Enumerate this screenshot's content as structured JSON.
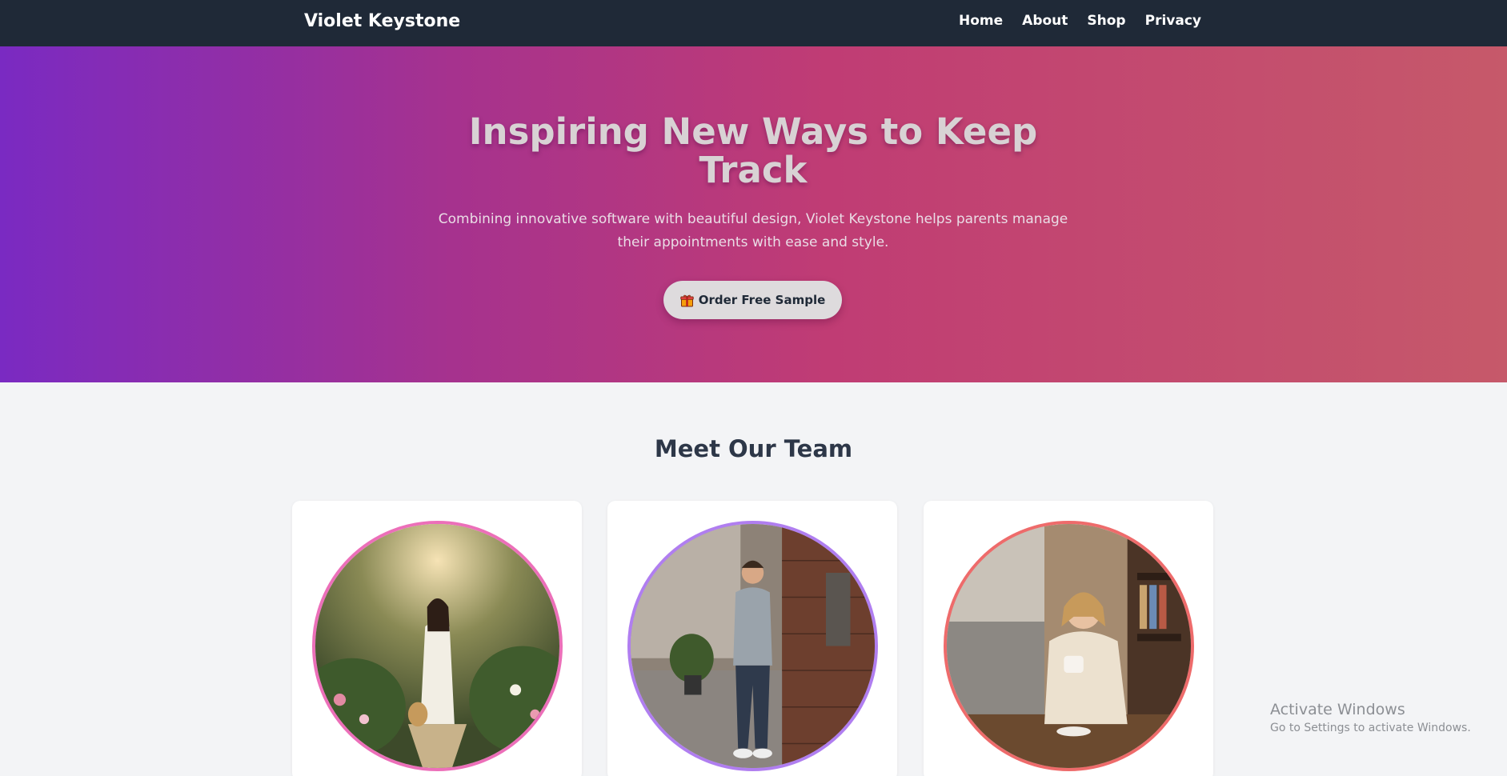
{
  "nav": {
    "brand": "Violet Keystone",
    "links": [
      "Home",
      "About",
      "Shop",
      "Privacy"
    ]
  },
  "hero": {
    "title": "Inspiring New Ways to Keep Track",
    "subtitle": "Combining innovative software with beautiful design, Violet Keystone helps parents manage their appointments with ease and style.",
    "cta_label": "Order Free Sample",
    "cta_icon": "gift-icon"
  },
  "team": {
    "title": "Meet Our Team",
    "members": [
      {
        "photo": "woman-in-garden-photo",
        "ring_color": "#ec6fb9"
      },
      {
        "photo": "man-leaning-on-brick-wall-photo",
        "ring_color": "#b07ef0"
      },
      {
        "photo": "woman-with-coffee-photo",
        "ring_color": "#ee6b6b"
      }
    ]
  },
  "watermark": {
    "title": "Activate Windows",
    "subtitle": "Go to Settings to activate Windows."
  },
  "colors": {
    "nav_bg": "#1f2937",
    "hero_gradient": [
      "#7a2ac2",
      "#a6328e",
      "#c03c74",
      "#c6596a"
    ],
    "page_bg": "#f3f4f6"
  }
}
